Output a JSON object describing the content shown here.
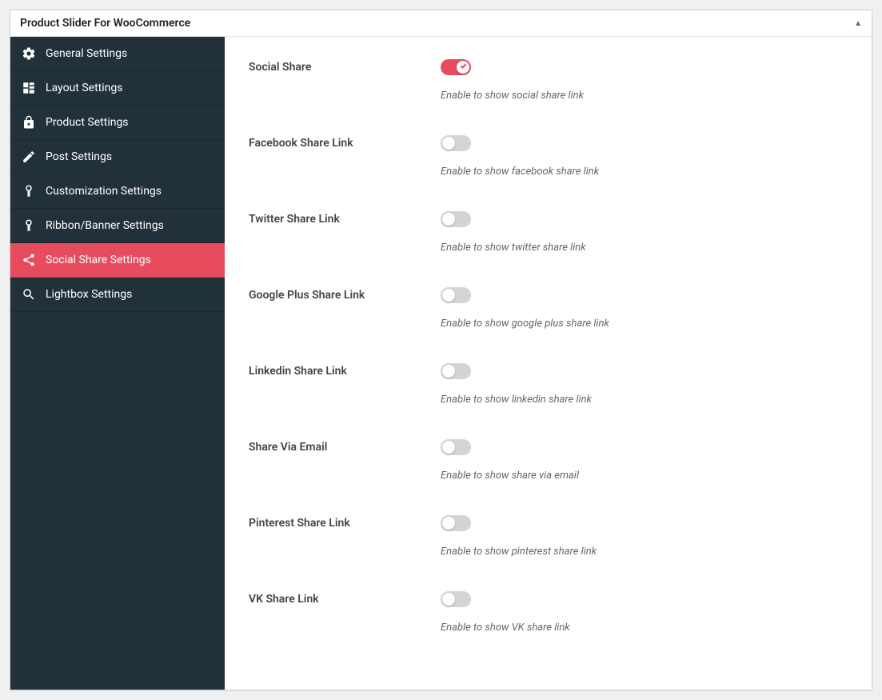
{
  "header": {
    "title": "Product Slider For WooCommerce"
  },
  "sidebar": {
    "items": [
      {
        "label": "General Settings",
        "icon": "gear-icon",
        "active": false
      },
      {
        "label": "Layout Settings",
        "icon": "layout-icon",
        "active": false
      },
      {
        "label": "Product Settings",
        "icon": "lock-icon",
        "active": false
      },
      {
        "label": "Post Settings",
        "icon": "edit-icon",
        "active": false
      },
      {
        "label": "Customization Settings",
        "icon": "ribbon-icon",
        "active": false
      },
      {
        "label": "Ribbon/Banner Settings",
        "icon": "ribbon-icon",
        "active": false
      },
      {
        "label": "Social Share Settings",
        "icon": "share-icon",
        "active": true
      },
      {
        "label": "Lightbox Settings",
        "icon": "search-icon",
        "active": false
      }
    ]
  },
  "settings": [
    {
      "label": "Social Share",
      "desc": "Enable to show social share link",
      "on": true
    },
    {
      "label": "Facebook Share Link",
      "desc": "Enable to show facebook share link",
      "on": false
    },
    {
      "label": "Twitter Share Link",
      "desc": "Enable to show twitter share link",
      "on": false
    },
    {
      "label": "Google Plus Share Link",
      "desc": "Enable to show google plus share link",
      "on": false
    },
    {
      "label": "Linkedin Share Link",
      "desc": "Enable to show linkedin share link",
      "on": false
    },
    {
      "label": "Share Via Email",
      "desc": "Enable to show share via email",
      "on": false
    },
    {
      "label": "Pinterest Share Link",
      "desc": "Enable to show pinterest share link",
      "on": false
    },
    {
      "label": "VK Share Link",
      "desc": "Enable to show VK share link",
      "on": false
    }
  ]
}
